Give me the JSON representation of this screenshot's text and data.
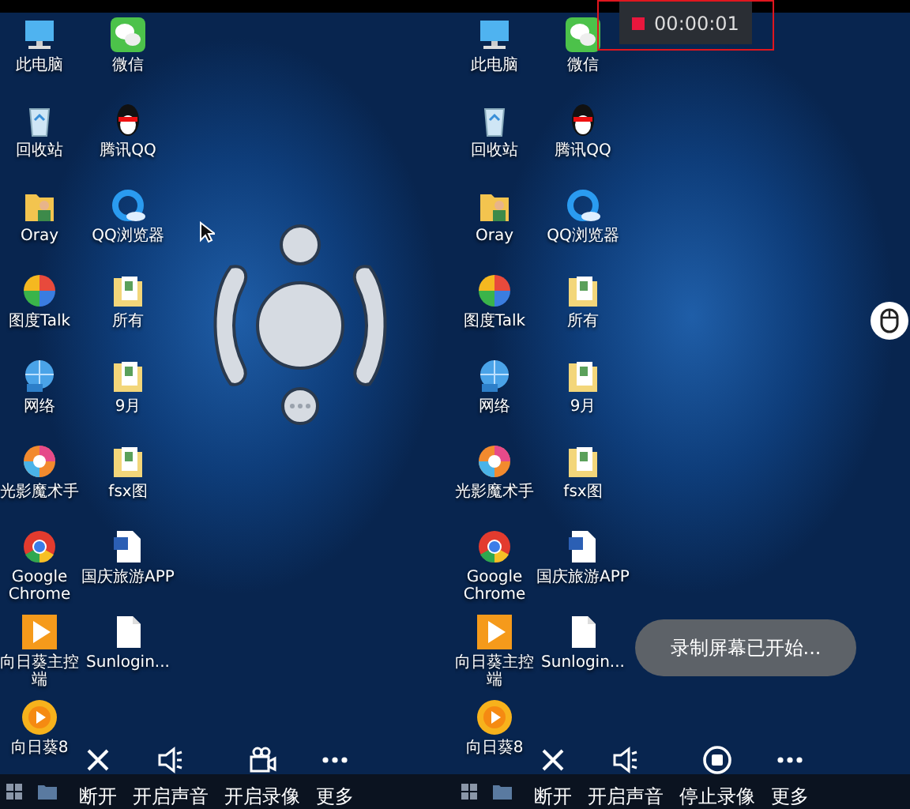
{
  "panels": [
    {
      "desktop_icons": [
        {
          "label": "此电脑",
          "kind": "computer"
        },
        {
          "label": "微信",
          "kind": "chat"
        },
        {
          "label": "回收站",
          "kind": "recycle"
        },
        {
          "label": "腾讯QQ",
          "kind": "penguin"
        },
        {
          "label": "Oray",
          "kind": "person-folder"
        },
        {
          "label": "QQ浏览器",
          "kind": "ring"
        },
        {
          "label": "图度Talk",
          "kind": "ball"
        },
        {
          "label": "所有",
          "kind": "folder"
        },
        {
          "label": "网络",
          "kind": "globe"
        },
        {
          "label": "9月",
          "kind": "folder"
        },
        {
          "label": "光影魔术手",
          "kind": "wheel"
        },
        {
          "label": "fsx图",
          "kind": "folder"
        },
        {
          "label": "Google Chrome",
          "kind": "chrome"
        },
        {
          "label": "国庆旅游APP",
          "kind": "word-doc"
        },
        {
          "label": "向日葵主控端",
          "kind": "play-tile"
        },
        {
          "label": "Sunlogin...",
          "kind": "doc"
        },
        {
          "label": "向日葵8",
          "kind": "sun"
        }
      ],
      "overlays": [
        {
          "kind": "cursor"
        },
        {
          "kind": "joystick"
        }
      ],
      "toolbar": [
        {
          "label": "断开",
          "kind": "close"
        },
        {
          "label": "开启声音",
          "kind": "speaker"
        },
        {
          "label": "开启录像",
          "kind": "camera"
        },
        {
          "label": "更多",
          "kind": "more"
        }
      ]
    },
    {
      "desktop_icons": [
        {
          "label": "此电脑",
          "kind": "computer"
        },
        {
          "label": "微信",
          "kind": "chat"
        },
        {
          "label": "回收站",
          "kind": "recycle"
        },
        {
          "label": "腾讯QQ",
          "kind": "penguin"
        },
        {
          "label": "Oray",
          "kind": "person-folder"
        },
        {
          "label": "QQ浏览器",
          "kind": "ring"
        },
        {
          "label": "图度Talk",
          "kind": "ball"
        },
        {
          "label": "所有",
          "kind": "folder"
        },
        {
          "label": "网络",
          "kind": "globe"
        },
        {
          "label": "9月",
          "kind": "folder"
        },
        {
          "label": "光影魔术手",
          "kind": "wheel"
        },
        {
          "label": "fsx图",
          "kind": "folder"
        },
        {
          "label": "Google Chrome",
          "kind": "chrome"
        },
        {
          "label": "国庆旅游APP",
          "kind": "word-doc"
        },
        {
          "label": "向日葵主控端",
          "kind": "play-tile"
        },
        {
          "label": "Sunlogin...",
          "kind": "doc"
        },
        {
          "label": "向日葵8",
          "kind": "sun"
        }
      ],
      "recording_timer": "00:00:01",
      "toast": "录制屏幕已开始...",
      "overlays": [
        {
          "kind": "mouse"
        }
      ],
      "toolbar": [
        {
          "label": "断开",
          "kind": "close"
        },
        {
          "label": "开启声音",
          "kind": "speaker"
        },
        {
          "label": "停止录像",
          "kind": "stop"
        },
        {
          "label": "更多",
          "kind": "more"
        }
      ]
    }
  ]
}
